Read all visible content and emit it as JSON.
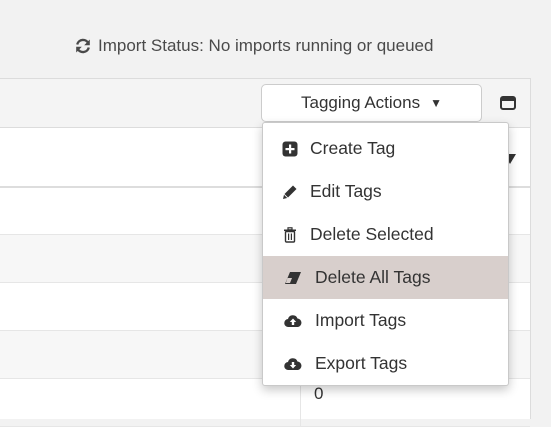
{
  "status": {
    "icon": "refresh-icon",
    "text": "Import Status: No imports running or queued"
  },
  "toolbar": {
    "tagging_actions_label": "Tagging Actions",
    "caret": "▼",
    "toggle_icon": "column-toggle-icon"
  },
  "table": {
    "rows": [
      {
        "value": ""
      },
      {
        "value": ""
      },
      {
        "value": ""
      },
      {
        "value": ""
      },
      {
        "value": ""
      },
      {
        "value": "0"
      }
    ]
  },
  "menu": {
    "items": [
      {
        "label": "Create Tag",
        "icon": "plus-square-icon"
      },
      {
        "label": "Edit Tags",
        "icon": "pencil-icon"
      },
      {
        "label": "Delete Selected",
        "icon": "trash-icon"
      },
      {
        "label": "Delete All Tags",
        "icon": "eraser-icon",
        "highlighted": true
      },
      {
        "label": "Import Tags",
        "icon": "cloud-upload-icon"
      },
      {
        "label": "Export Tags",
        "icon": "cloud-download-icon"
      }
    ]
  },
  "colors": {
    "highlight": "#d8cfcc",
    "text": "#333333"
  }
}
